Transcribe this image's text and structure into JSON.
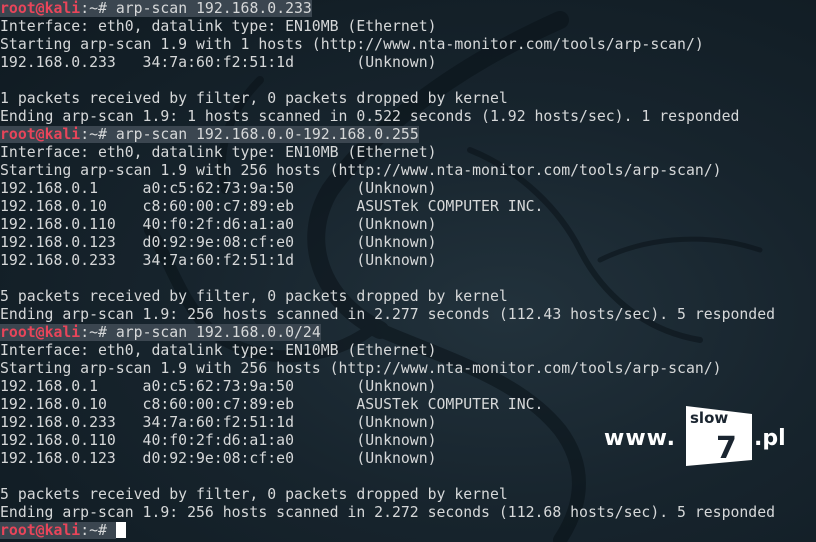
{
  "prompt": {
    "user": "root",
    "at": "@",
    "host": "kali",
    "sep": ":~# "
  },
  "lines": [
    {
      "kind": "prompt",
      "cmd": "arp-scan 192.168.0.233"
    },
    {
      "kind": "text",
      "text": "Interface: eth0, datalink type: EN10MB (Ethernet)"
    },
    {
      "kind": "text",
      "text": "Starting arp-scan 1.9 with 1 hosts (http://www.nta-monitor.com/tools/arp-scan/)"
    },
    {
      "kind": "text",
      "text": "192.168.0.233   34:7a:60:f2:51:1d       (Unknown)"
    },
    {
      "kind": "text",
      "text": ""
    },
    {
      "kind": "text",
      "text": "1 packets received by filter, 0 packets dropped by kernel"
    },
    {
      "kind": "text",
      "text": "Ending arp-scan 1.9: 1 hosts scanned in 0.522 seconds (1.92 hosts/sec). 1 responded"
    },
    {
      "kind": "prompt",
      "cmd": "arp-scan 192.168.0.0-192.168.0.255"
    },
    {
      "kind": "text",
      "text": "Interface: eth0, datalink type: EN10MB (Ethernet)"
    },
    {
      "kind": "text",
      "text": "Starting arp-scan 1.9 with 256 hosts (http://www.nta-monitor.com/tools/arp-scan/)"
    },
    {
      "kind": "text",
      "text": "192.168.0.1     a0:c5:62:73:9a:50       (Unknown)"
    },
    {
      "kind": "text",
      "text": "192.168.0.10    c8:60:00:c7:89:eb       ASUSTek COMPUTER INC."
    },
    {
      "kind": "text",
      "text": "192.168.0.110   40:f0:2f:d6:a1:a0       (Unknown)"
    },
    {
      "kind": "text",
      "text": "192.168.0.123   d0:92:9e:08:cf:e0       (Unknown)"
    },
    {
      "kind": "text",
      "text": "192.168.0.233   34:7a:60:f2:51:1d       (Unknown)"
    },
    {
      "kind": "text",
      "text": ""
    },
    {
      "kind": "text",
      "text": "5 packets received by filter, 0 packets dropped by kernel"
    },
    {
      "kind": "text",
      "text": "Ending arp-scan 1.9: 256 hosts scanned in 2.277 seconds (112.43 hosts/sec). 5 responded"
    },
    {
      "kind": "prompt",
      "cmd": "arp-scan 192.168.0.0/24"
    },
    {
      "kind": "text",
      "text": "Interface: eth0, datalink type: EN10MB (Ethernet)"
    },
    {
      "kind": "text",
      "text": "Starting arp-scan 1.9 with 256 hosts (http://www.nta-monitor.com/tools/arp-scan/)"
    },
    {
      "kind": "text",
      "text": "192.168.0.1     a0:c5:62:73:9a:50       (Unknown)"
    },
    {
      "kind": "text",
      "text": "192.168.0.10    c8:60:00:c7:89:eb       ASUSTek COMPUTER INC."
    },
    {
      "kind": "text",
      "text": "192.168.0.233   34:7a:60:f2:51:1d       (Unknown)"
    },
    {
      "kind": "text",
      "text": "192.168.0.110   40:f0:2f:d6:a1:a0       (Unknown)"
    },
    {
      "kind": "text",
      "text": "192.168.0.123   d0:92:9e:08:cf:e0       (Unknown)"
    },
    {
      "kind": "text",
      "text": ""
    },
    {
      "kind": "text",
      "text": "5 packets received by filter, 0 packets dropped by kernel"
    },
    {
      "kind": "text",
      "text": "Ending arp-scan 1.9: 256 hosts scanned in 2.272 seconds (112.68 hosts/sec). 5 responded"
    },
    {
      "kind": "prompt-active",
      "cmd": ""
    }
  ],
  "watermark": {
    "www": "www.",
    "top": "slow",
    "number": "7",
    "tld": ".pl"
  },
  "colors": {
    "background": "#17242d",
    "text": "#d6d8d9",
    "prompt_user": "#e8455a",
    "prompt_highlight": "#3b4650",
    "cursor": "#ffffff"
  },
  "icons": {
    "background": "kali-dragon-icon",
    "watermark": "slow7-logo-icon"
  }
}
